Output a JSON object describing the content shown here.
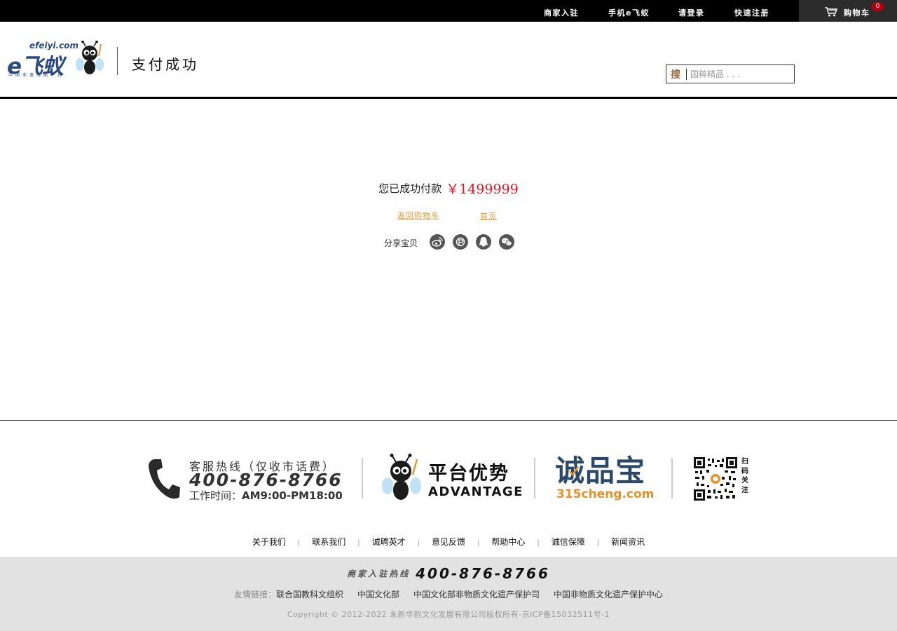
{
  "topbar": {
    "nav": [
      "商家入驻",
      "手机e飞蚁",
      "请登录",
      "快速注册"
    ],
    "cart_label": "购物车",
    "cart_count": "0"
  },
  "header": {
    "logo": {
      "domain": "efeiyi.com",
      "main": "e飞蚁",
      "sub": "中国非遗电商平台"
    },
    "page_title": "支付成功",
    "search": {
      "icon_text": "搜",
      "placeholder": "国粹精品 . . ."
    }
  },
  "main": {
    "success_text": "您已成功付款",
    "amount": "￥1499999",
    "back_to_cart": "返回购物车",
    "home": "首页",
    "share_label": "分享宝贝",
    "share_icons": [
      "weibo-icon",
      "qq-space-icon",
      "qq-icon",
      "wechat-icon"
    ]
  },
  "footer": {
    "hotline_label": "客服热线（仅收市话费）",
    "hotline_number": "400-876-8766",
    "work_hours_label": "工作时间：",
    "work_hours_value": "AM9:00-PM18:00",
    "advantage_title": "平台优势",
    "advantage_sub": "ADVANTAGE",
    "chengpinbao_title": "诚品宝",
    "chengpinbao_url": "315cheng.com",
    "qr_caption": "扫码关注",
    "links": [
      "关于我们",
      "联系我们",
      "诚聘英才",
      "意见反馈",
      "帮助中心",
      "诚信保障",
      "新闻资讯"
    ],
    "merchant_label": "商家入驻热线",
    "merchant_number": "400-876-8766",
    "friend_label": "友情链接：",
    "friend_links": [
      "联合国教科文组织",
      "中国文化部",
      "中国文化部非物质文化遗产保护司",
      "中国非物质文化遗产保护中心"
    ],
    "copyright": "Copyright © 2012-2022 永新华韵文化发展有限公司版权所有-京ICP备15032511号-1"
  },
  "colors": {
    "amount_red": "#e4121e",
    "link_orange": "#e39a3a",
    "brand_blue": "#2c4a82",
    "cpb_orange": "#e9902b"
  }
}
